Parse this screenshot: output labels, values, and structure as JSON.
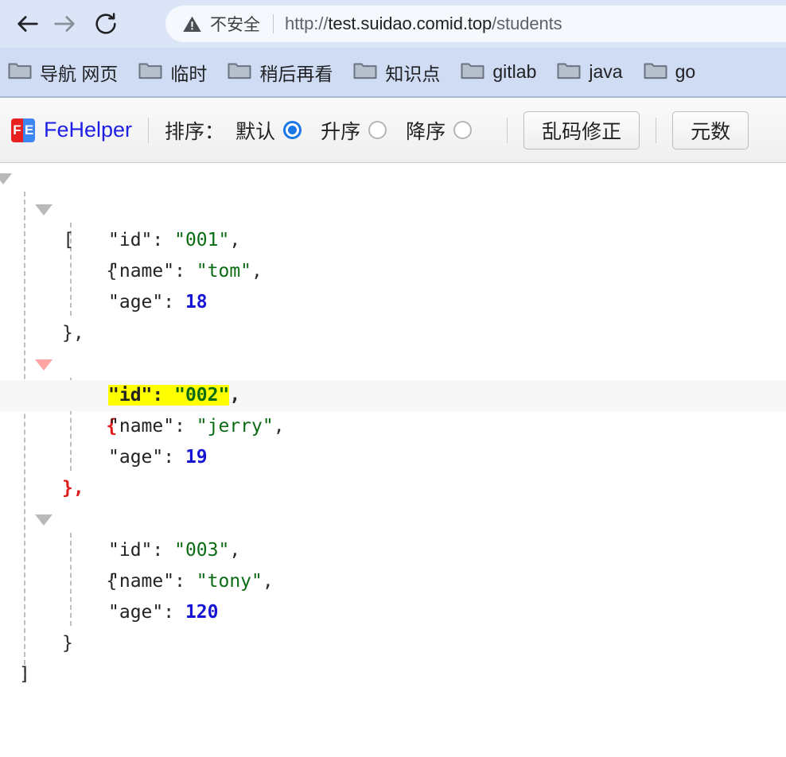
{
  "browser": {
    "back_icon": "back-arrow-icon",
    "forward_icon": "forward-arrow-icon",
    "reload_icon": "reload-icon",
    "security_warning_icon": "warning-triangle-icon",
    "security_label": "不安全",
    "url_scheme": "http://",
    "url_host": "test.suidao.comid.top",
    "url_path": "/students"
  },
  "bookmarks": {
    "items": [
      {
        "label": "导航 网页",
        "icon": "folder-icon"
      },
      {
        "label": "临时",
        "icon": "folder-icon"
      },
      {
        "label": "稍后再看",
        "icon": "folder-icon"
      },
      {
        "label": "知识点",
        "icon": "folder-icon"
      },
      {
        "label": "gitlab",
        "icon": "folder-icon"
      },
      {
        "label": "java",
        "icon": "folder-icon"
      },
      {
        "label": "go",
        "icon": "folder-icon"
      }
    ]
  },
  "fehelper": {
    "logo_left": "F",
    "logo_right": "E",
    "brand": "FeHelper",
    "sort_label": "排序：",
    "sort_options": [
      {
        "label": "默认",
        "checked": true
      },
      {
        "label": "升序",
        "checked": false
      },
      {
        "label": "降序",
        "checked": false
      }
    ],
    "buttons": [
      {
        "label": "乱码修正"
      },
      {
        "label": "元数"
      }
    ]
  },
  "json_view": {
    "root_open": "[",
    "root_close": "]",
    "records": [
      {
        "open": "{",
        "close": "},",
        "highlighted": false,
        "fields": [
          {
            "key": "\"id\"",
            "sep": ": ",
            "value": "\"001\"",
            "type": "string",
            "comma": ","
          },
          {
            "key": "\"name\"",
            "sep": ": ",
            "value": "\"tom\"",
            "type": "string",
            "comma": ","
          },
          {
            "key": "\"age\"",
            "sep": ": ",
            "value": "18",
            "type": "number",
            "comma": ""
          }
        ]
      },
      {
        "open": "{",
        "close": "},",
        "highlighted": true,
        "fields": [
          {
            "key": "\"id\"",
            "sep": ": ",
            "value": "\"002\"",
            "type": "string",
            "comma": ",",
            "marked": true
          },
          {
            "key": "\"name\"",
            "sep": ": ",
            "value": "\"jerry\"",
            "type": "string",
            "comma": ","
          },
          {
            "key": "\"age\"",
            "sep": ": ",
            "value": "19",
            "type": "number",
            "comma": ""
          }
        ]
      },
      {
        "open": "{",
        "close": "}",
        "highlighted": false,
        "fields": [
          {
            "key": "\"id\"",
            "sep": ": ",
            "value": "\"003\"",
            "type": "string",
            "comma": ","
          },
          {
            "key": "\"name\"",
            "sep": ": ",
            "value": "\"tony\"",
            "type": "string",
            "comma": ","
          },
          {
            "key": "\"age\"",
            "sep": ": ",
            "value": "120",
            "type": "number",
            "comma": ""
          }
        ]
      }
    ]
  }
}
